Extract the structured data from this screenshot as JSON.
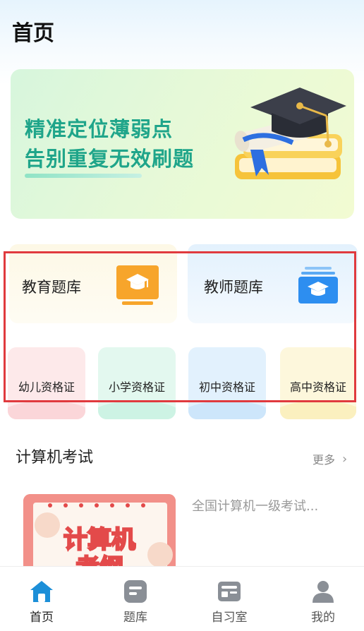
{
  "header": {
    "title": "首页"
  },
  "banner": {
    "line1": "精准定位薄弱点",
    "line2": "告别重复无效刷题"
  },
  "banks": [
    {
      "label": "教育题库",
      "icon": "graduation-cap-monitor-icon"
    },
    {
      "label": "教师题库",
      "icon": "graduation-cap-stack-icon"
    }
  ],
  "certificates": [
    {
      "label": "幼儿资格证"
    },
    {
      "label": "小学资格证"
    },
    {
      "label": "初中资格证"
    },
    {
      "label": "高中资格证"
    }
  ],
  "section": {
    "title": "计算机考试",
    "more": "更多",
    "course": {
      "title": "全国计算机一级考试...",
      "thumb_text": "计算机考纲"
    }
  },
  "tabbar": [
    {
      "label": "首页",
      "icon": "home-icon",
      "active": true
    },
    {
      "label": "题库",
      "icon": "question-bank-icon",
      "active": false
    },
    {
      "label": "自习室",
      "icon": "study-room-icon",
      "active": false
    },
    {
      "label": "我的",
      "icon": "profile-icon",
      "active": false
    }
  ],
  "colors": {
    "accent": "#1c8fd8",
    "banner_text": "#1fa58a",
    "highlight": "#e03a3e",
    "edu_icon": "#f5a623",
    "teacher_icon": "#2d8ef0"
  }
}
